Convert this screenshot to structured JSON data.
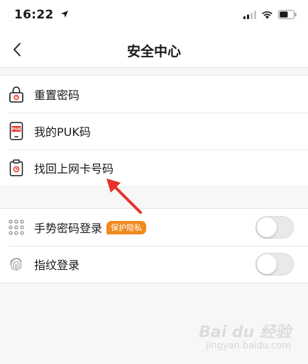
{
  "status_bar": {
    "time": "16:22",
    "location_icon": "location-arrow-icon",
    "signal_icon": "cellular-signal-icon",
    "wifi_icon": "wifi-icon",
    "battery_icon": "battery-icon",
    "battery_level": 0.6
  },
  "nav": {
    "back_icon": "chevron-left-icon",
    "title": "安全中心"
  },
  "security_items": [
    {
      "label": "重置密码",
      "icon": "lock-icon"
    },
    {
      "label": "我的PUK码",
      "icon": "puk-card-icon",
      "icon_text": "PUK"
    },
    {
      "label": "找回上网卡号码",
      "icon": "clipboard-clock-icon"
    }
  ],
  "login_items": [
    {
      "label": "手势密码登录",
      "icon": "gesture-dots-icon",
      "badge": "保护隐私",
      "toggle_on": false
    },
    {
      "label": "指纹登录",
      "icon": "fingerprint-icon",
      "toggle_on": false
    }
  ],
  "annotation": {
    "icon": "red-arrow-annotation"
  },
  "watermark": {
    "main": "Bai du 经验",
    "sub": "jingyan.baidu.com"
  },
  "colors": {
    "accent_red": "#e8312a",
    "badge_orange": "#f08a1e",
    "toggle_off": "#e9e9ea",
    "background": "#f7f7f7"
  }
}
